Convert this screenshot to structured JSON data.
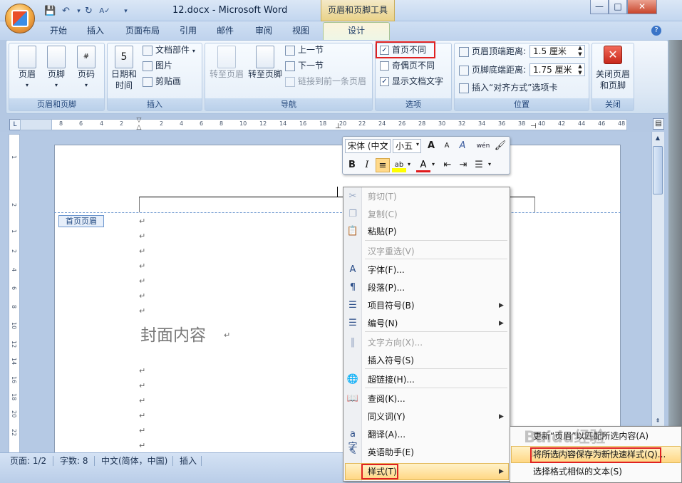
{
  "title_bar": {
    "doc_title": "12.docx - Microsoft Word",
    "context_tab": "页眉和页脚工具",
    "minimize": "—",
    "maximize": "□",
    "close": "✕"
  },
  "tabs": [
    "开始",
    "插入",
    "页面布局",
    "引用",
    "邮件",
    "审阅",
    "视图"
  ],
  "active_tab": "设计",
  "ribbon": {
    "group_header_footer": {
      "label": "页眉和页脚",
      "header": "页眉",
      "footer": "页脚",
      "page_number": "页码"
    },
    "group_insert": {
      "label": "插入",
      "date_time": "日期和\n时间",
      "date_time_line1": "日期和",
      "date_time_line2": "时间",
      "doc_parts": "文档部件",
      "picture": "图片",
      "clip_art": "剪贴画"
    },
    "group_nav": {
      "label": "导航",
      "goto_header": "转至页眉",
      "goto_footer": "转至页脚",
      "prev": "上一节",
      "next": "下一节",
      "link_prev": "链接到前一条页眉"
    },
    "group_options": {
      "label": "选项",
      "diff_first": "首页不同",
      "diff_odd_even": "奇偶页不同",
      "show_text": "显示文档文字"
    },
    "group_position": {
      "label": "位置",
      "header_dist_label": "页眉顶端距离:",
      "header_dist_value": "1.5 厘米",
      "footer_dist_label": "页脚底端距离:",
      "footer_dist_value": "1.75 厘米",
      "align_tab": "插入“对齐方式”选项卡"
    },
    "group_close": {
      "label": "关闭",
      "close_line1": "关闭页眉",
      "close_line2": "和页脚"
    }
  },
  "ruler": {
    "h_ticks": [
      "8",
      "6",
      "4",
      "2",
      "2",
      "4",
      "6",
      "8",
      "10",
      "12",
      "14",
      "16",
      "18",
      "20",
      "22",
      "24",
      "26",
      "28",
      "30",
      "32",
      "34",
      "36",
      "38",
      "40",
      "42",
      "44",
      "46",
      "48"
    ],
    "v_ticks": [
      "1",
      "2",
      "1",
      "2",
      "4",
      "6",
      "8",
      "10",
      "12",
      "14",
      "16",
      "18",
      "20",
      "22"
    ]
  },
  "document": {
    "header_tag": "首页页眉",
    "cover_text": "封面内容",
    "para_mark": "↵"
  },
  "mini_toolbar": {
    "font": "宋体 (中文",
    "size": "小五",
    "grow": "A",
    "shrink": "A",
    "bold": "B",
    "italic": "I"
  },
  "context_menu": {
    "items": [
      {
        "label": "剪切(T)",
        "icon": "✂",
        "enabled": false
      },
      {
        "label": "复制(C)",
        "icon": "❐",
        "enabled": false
      },
      {
        "label": "粘贴(P)",
        "icon": "📋",
        "enabled": true
      },
      {
        "label": "汉字重选(V)",
        "icon": "",
        "enabled": false
      },
      {
        "label": "字体(F)...",
        "icon": "A",
        "enabled": true
      },
      {
        "label": "段落(P)...",
        "icon": "¶",
        "enabled": true
      },
      {
        "label": "项目符号(B)",
        "icon": "☰",
        "enabled": true
      },
      {
        "label": "编号(N)",
        "icon": "☰",
        "enabled": true
      },
      {
        "label": "文字方向(X)...",
        "icon": "‖",
        "enabled": false
      },
      {
        "label": "插入符号(S)",
        "icon": "",
        "enabled": true
      },
      {
        "label": "超链接(H)...",
        "icon": "🌐",
        "enabled": true
      },
      {
        "label": "查阅(K)...",
        "icon": "📖",
        "enabled": true
      },
      {
        "label": "同义词(Y)",
        "icon": "",
        "enabled": true
      },
      {
        "label": "翻译(A)...",
        "icon": "a字",
        "enabled": true
      },
      {
        "label": "英语助手(E)",
        "icon": "✎",
        "enabled": true
      },
      {
        "label": "样式(T)",
        "icon": "",
        "enabled": true
      }
    ]
  },
  "submenu": {
    "items": [
      "更新“页眉”以匹配所选内容(A)",
      "将所选内容保存为新快速样式(Q)...",
      "选择格式相似的文本(S)"
    ]
  },
  "status_bar": {
    "page": "页面: 1/2",
    "words": "字数: 8",
    "lang": "中文(简体，中国)",
    "mode": "插入"
  },
  "watermark": "Baidu经验",
  "watermark_url": "jingyan.baidu.com"
}
